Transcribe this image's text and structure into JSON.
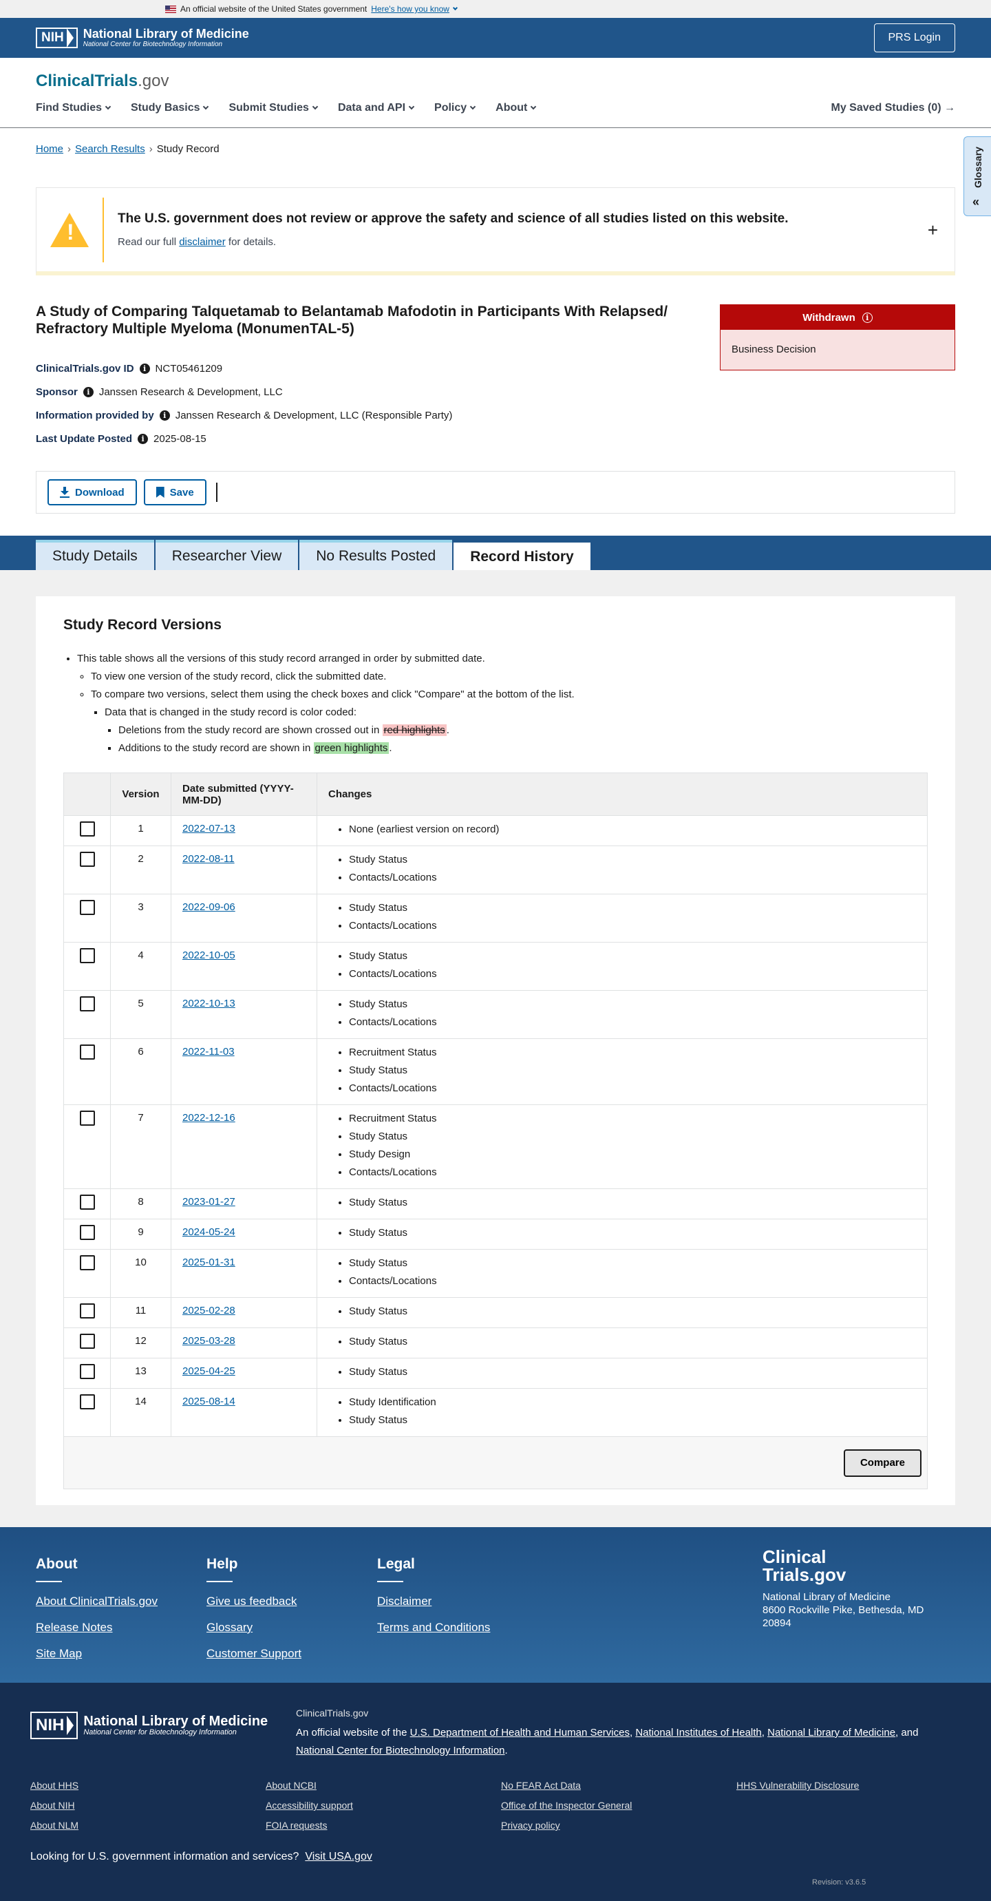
{
  "gov_banner": {
    "text": "An official website of the United States government",
    "link": "Here's how you know"
  },
  "nih_bar": {
    "logo_abbr": "NIH",
    "logo_title": "National Library of Medicine",
    "logo_subtitle": "National Center for Biotechnology Information",
    "prs_login": "PRS Login"
  },
  "brand": {
    "name": "ClinicalTrials",
    "suffix": ".gov"
  },
  "nav": {
    "items": [
      "Find Studies",
      "Study Basics",
      "Submit Studies",
      "Data and API",
      "Policy",
      "About"
    ],
    "saved": "My Saved Studies (0) →"
  },
  "glossary": {
    "label": "Glossary",
    "chevron": "«"
  },
  "breadcrumb": {
    "home": "Home",
    "search": "Search Results",
    "current": "Study Record",
    "sep": "›"
  },
  "alert": {
    "heading": "The U.S. government does not review or approve the safety and science of all studies listed on this website.",
    "pre": "Read our full ",
    "link": "disclaimer",
    "post": " for details.",
    "toggle": "+"
  },
  "study": {
    "title": "A Study of Comparing Talquetamab to Belantamab Mafodotin in Participants With Relapsed/ Refractory Multiple Myeloma (MonumenTAL-5)",
    "meta": [
      {
        "label": "ClinicalTrials.gov ID",
        "value": "NCT05461209"
      },
      {
        "label": "Sponsor",
        "value": "Janssen Research & Development, LLC"
      },
      {
        "label": "Information provided by",
        "value": "Janssen Research & Development, LLC (Responsible Party)"
      },
      {
        "label": "Last Update Posted",
        "value": "2025-08-15"
      }
    ],
    "status": "Withdrawn",
    "status_reason": "Business Decision",
    "info_glyph": "i"
  },
  "actions": {
    "download": "Download",
    "save": "Save"
  },
  "tabs": [
    {
      "label": "Study Details",
      "active": false
    },
    {
      "label": "Researcher View",
      "active": false
    },
    {
      "label": "No Results Posted",
      "active": false
    },
    {
      "label": "Record History",
      "active": true
    }
  ],
  "versions": {
    "heading": "Study Record Versions",
    "intro": {
      "l1": "This table shows all the versions of this study record arranged in order by submitted date.",
      "l2": "To view one version of the study record, click the submitted date.",
      "l3": "To compare two versions, select them using the check boxes and click \"Compare\" at the bottom of the list.",
      "l4": "Data that is changed in the study record is color coded:",
      "l5_pre": "Deletions from the study record are shown crossed out in ",
      "l5_mark": "red highlights",
      "l5_post": ".",
      "l6_pre": "Additions to the study record are shown in ",
      "l6_mark": "green highlights",
      "l6_post": "."
    },
    "columns": [
      "",
      "Version",
      "Date submitted (YYYY-MM-DD)",
      "Changes"
    ],
    "rows": [
      {
        "version": "1",
        "date": "2022-07-13",
        "changes": [
          "None (earliest version on record)"
        ]
      },
      {
        "version": "2",
        "date": "2022-08-11",
        "changes": [
          "Study Status",
          "Contacts/Locations"
        ]
      },
      {
        "version": "3",
        "date": "2022-09-06",
        "changes": [
          "Study Status",
          "Contacts/Locations"
        ]
      },
      {
        "version": "4",
        "date": "2022-10-05",
        "changes": [
          "Study Status",
          "Contacts/Locations"
        ]
      },
      {
        "version": "5",
        "date": "2022-10-13",
        "changes": [
          "Study Status",
          "Contacts/Locations"
        ]
      },
      {
        "version": "6",
        "date": "2022-11-03",
        "changes": [
          "Recruitment Status",
          "Study Status",
          "Contacts/Locations"
        ]
      },
      {
        "version": "7",
        "date": "2022-12-16",
        "changes": [
          "Recruitment Status",
          "Study Status",
          "Study Design",
          "Contacts/Locations"
        ]
      },
      {
        "version": "8",
        "date": "2023-01-27",
        "changes": [
          "Study Status"
        ]
      },
      {
        "version": "9",
        "date": "2024-05-24",
        "changes": [
          "Study Status"
        ]
      },
      {
        "version": "10",
        "date": "2025-01-31",
        "changes": [
          "Study Status",
          "Contacts/Locations"
        ]
      },
      {
        "version": "11",
        "date": "2025-02-28",
        "changes": [
          "Study Status"
        ]
      },
      {
        "version": "12",
        "date": "2025-03-28",
        "changes": [
          "Study Status"
        ]
      },
      {
        "version": "13",
        "date": "2025-04-25",
        "changes": [
          "Study Status"
        ]
      },
      {
        "version": "14",
        "date": "2025-08-14",
        "changes": [
          "Study Identification",
          "Study Status"
        ]
      }
    ],
    "compare": "Compare"
  },
  "footer": {
    "about": {
      "title": "About",
      "links": [
        "About ClinicalTrials.gov",
        "Release Notes",
        "Site Map"
      ]
    },
    "help": {
      "title": "Help",
      "links": [
        "Give us feedback",
        "Glossary",
        "Customer Support"
      ]
    },
    "legal": {
      "title": "Legal",
      "links": [
        "Disclaimer",
        "Terms and Conditions"
      ]
    },
    "brand_line1": "Clinical",
    "brand_line2": "Trials.gov",
    "address": [
      "National Library of Medicine",
      "8600 Rockville Pike, Bethesda, MD",
      "20894"
    ]
  },
  "nlm_footer": {
    "logo_abbr": "NIH",
    "logo_title": "National Library of Medicine",
    "logo_subtitle": "National Center for Biotechnology Information",
    "site": "ClinicalTrials.gov",
    "official_pre": "An official website of the ",
    "hhs": "U.S. Department of Health and Human Services",
    "sep1": ", ",
    "nih": "National Institutes of Health",
    "sep2": ", ",
    "nlm": "National Library of Medicine",
    "sep3": ", and ",
    "ncbi": "National Center for Biotechnology Information",
    "end": ".",
    "col1": [
      "About HHS",
      "About NIH",
      "About NLM"
    ],
    "col2": [
      "About NCBI",
      "Accessibility support",
      "FOIA requests"
    ],
    "col3": [
      "No FEAR Act Data",
      "Office of the Inspector General",
      "Privacy policy"
    ],
    "col4": [
      "HHS Vulnerability Disclosure"
    ],
    "usa_pre": "Looking for U.S. government information and services?",
    "usa_link": "Visit USA.gov",
    "revision": "Revision: v3.6.5"
  }
}
